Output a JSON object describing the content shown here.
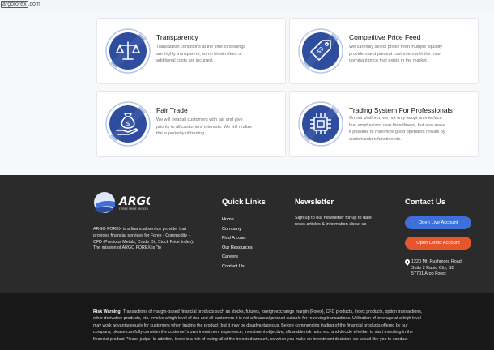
{
  "address_bar": {
    "highlighted": "argoforex",
    "rest": ".com"
  },
  "features": [
    {
      "icon": "balance-scale-icon",
      "title": "Transparency",
      "lines": [
        "Transaction conditions at the time of dealings",
        "are highly transparent, so no hidden fees or",
        "additional costs are incurred."
      ]
    },
    {
      "icon": "price-tag-icon",
      "title": "Competitive Price Feed",
      "lines": [
        "We carefully select prices from multiple liquidity",
        "providers and present customers with the most",
        "dominant price that exists in the market."
      ]
    },
    {
      "icon": "money-bag-hand-icon",
      "title": "Fair Trade",
      "lines": [
        "We will treat all customers with fair and give",
        "priority to all customers' interests. We will realize",
        "the superiority of trading."
      ]
    },
    {
      "icon": "cpu-chip-icon",
      "title": "Trading System For Professionals",
      "lines": [
        "On our platform, we not only adopt an interface",
        "that emphasizes user friendliness, but also make",
        "it possible to maximize good operation results by",
        "customization function etc."
      ]
    }
  ],
  "footer": {
    "logo_text": "ARGO",
    "logo_sub": "FOREX PRIME BROKER",
    "description_lines": [
      "ARGO FOREX is a financial service provider that",
      "provides financial services for Forex · Commodity ·",
      "CFD (Precious Metals, Crude Oil, Stock Price Index).",
      "The mission of ARGO FOREX is \"to"
    ],
    "quick_links_title": "Quick Links",
    "quick_links": [
      "Home",
      "Company",
      "Find A Loan",
      "Our Resources",
      "Careers",
      "Contact Us"
    ],
    "newsletter_title": "Newsletter",
    "newsletter_lines": [
      "Sign up to our newsletter for up to date",
      "news articles & information about us"
    ],
    "contact_title": "Contact Us",
    "open_live_label": "Open Live Account",
    "open_demo_label": "Open Demo Account",
    "address_lines": [
      "1220 Mt. Rushmore Road,",
      "Suite 2 Rapid City, SD",
      "57701 Argo Forex"
    ]
  },
  "risk": {
    "label": "Risk Warning:",
    "lines": [
      "Transactions of margin-based financial products such as stocks, futures, foreign exchange margin (Forex), CFD products, index products, option transactions,",
      "other derivative products, etc. involve a high level of risk and all customers it is not a financial product suitable for receiving transactions. Utilization of leverage at a high level",
      "may work advantageously for customers when trading the product, but it may be disadvantageous. Before commencing trading of the financial products offered by our",
      "company, please carefully consider the customer's own investment experience, investment objective, allowable risk ratio, etc. and decide whether to start investing in the",
      "financial product Please judge. In addition, there is a risk of losing all of the invested amount, so when you make an investment decision, we would like you to conduct"
    ]
  },
  "colors": {
    "icon_circle": "#2f4d9e",
    "icon_ring": "#b9c6e8",
    "footer_bg": "#2b2b2b",
    "risk_bg": "#181818",
    "live_button": "#3f6fd8",
    "demo_button": "#e7552c"
  }
}
